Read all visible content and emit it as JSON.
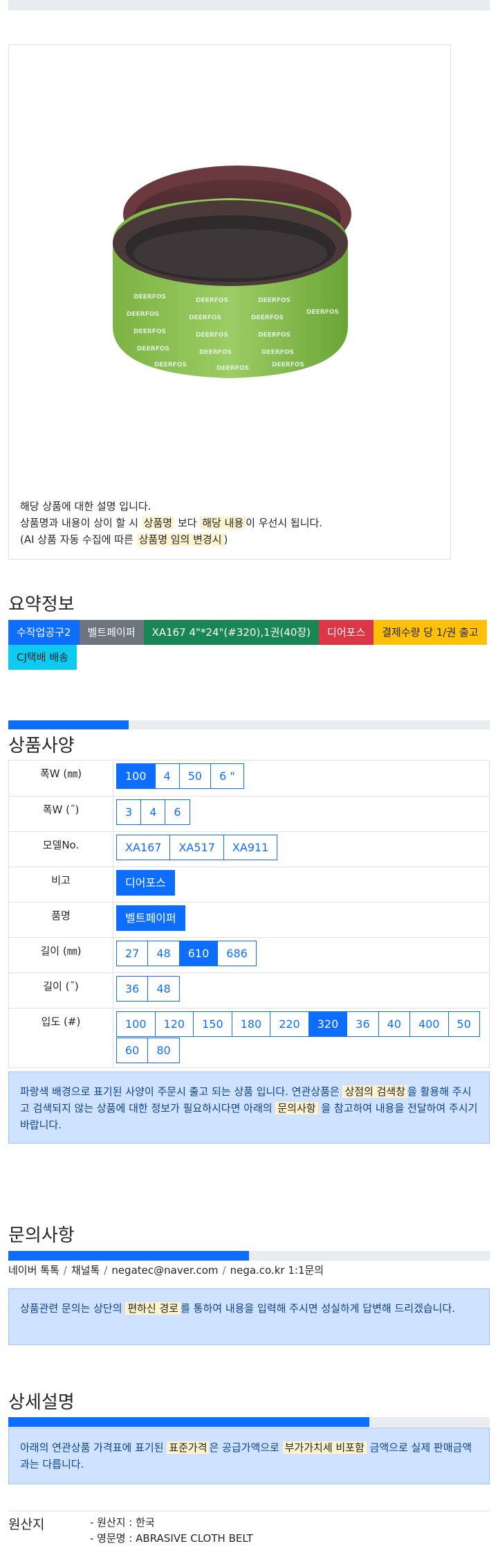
{
  "product_image": {
    "alt": "DEERFOS sanding belts",
    "desc_line1": "해당 상품에 대한 설명 입니다.",
    "desc_line2_a": "상품명과 내용이 상이 할 시 ",
    "desc_line2_mark1": "상품명",
    "desc_line2_b": " 보다 ",
    "desc_line2_mark2": "해당 내용",
    "desc_line2_c": "이 우선시 됩니다.",
    "desc_line3_a": "(AI 상품 자동 수집에 따른 ",
    "desc_line3_mark": "상품명 임의 변경시",
    "desc_line3_b": ")"
  },
  "summary": {
    "title": "요약정보",
    "badges": [
      {
        "label": "수작업공구2",
        "color": "#0d6efd",
        "text": "#ffffff"
      },
      {
        "label": "벨트페이퍼",
        "color": "#6c757d",
        "text": "#ffffff"
      },
      {
        "label": "XA167 4\"*24\"(#320),1권(40장)",
        "color": "#198754",
        "text": "#ffffff"
      },
      {
        "label": "디어포스",
        "color": "#dc3545",
        "text": "#ffffff"
      },
      {
        "label": "결제수량 당 1/권 출고",
        "color": "#ffc107",
        "text": "#212529"
      },
      {
        "label": "CJ택배 배송",
        "color": "#0dcaf0",
        "text": "#212529"
      }
    ]
  },
  "spec": {
    "progress": 0.25,
    "title": "상품사양",
    "rows": [
      {
        "label": "폭W (㎜)",
        "options": [
          {
            "v": "100",
            "on": true
          },
          {
            "v": "4",
            "on": false
          },
          {
            "v": "50",
            "on": false
          },
          {
            "v": "6 \"",
            "on": false
          }
        ]
      },
      {
        "label": "폭W (˝)",
        "options": [
          {
            "v": "3",
            "on": false
          },
          {
            "v": "4",
            "on": false
          },
          {
            "v": "6",
            "on": false
          }
        ]
      },
      {
        "label": "모델No.",
        "options": [
          {
            "v": "XA167",
            "on": false
          },
          {
            "v": "XA517",
            "on": false
          },
          {
            "v": "XA911",
            "on": false
          }
        ]
      },
      {
        "label": "비고",
        "options": [
          {
            "v": "디어포스",
            "on": true
          }
        ]
      },
      {
        "label": "품명",
        "options": [
          {
            "v": "벨트페이퍼",
            "on": true
          }
        ]
      },
      {
        "label": "길이 (㎜)",
        "options": [
          {
            "v": "27",
            "on": false
          },
          {
            "v": "48",
            "on": false
          },
          {
            "v": "610",
            "on": true
          },
          {
            "v": "686",
            "on": false
          }
        ]
      },
      {
        "label": "길이 (˝)",
        "options": [
          {
            "v": "36",
            "on": false
          },
          {
            "v": "48",
            "on": false
          }
        ]
      },
      {
        "label": "입도 (#)",
        "options": [
          {
            "v": "100",
            "on": false
          },
          {
            "v": "120",
            "on": false
          },
          {
            "v": "150",
            "on": false
          },
          {
            "v": "180",
            "on": false
          },
          {
            "v": "220",
            "on": false
          },
          {
            "v": "320",
            "on": true
          },
          {
            "v": "36",
            "on": false
          },
          {
            "v": "40",
            "on": false
          },
          {
            "v": "400",
            "on": false
          },
          {
            "v": "50",
            "on": false
          },
          {
            "v": "60",
            "on": false
          },
          {
            "v": "80",
            "on": false
          }
        ]
      }
    ],
    "notice_a": "파랑색 배경으로 표기된 사양이 주문시 출고 되는 상품 입니다. 연관상품은 ",
    "notice_mark1": "상점의 검색창",
    "notice_b": "을 활용해 주시고 검색되지 않는 상품에 대한 정보가 필요하시다면 아래의 ",
    "notice_mark2": "문의사항",
    "notice_c": " 을 참고하여 내용을 전달하여 주시기 바랍니다."
  },
  "inquiry": {
    "title": "문의사항",
    "progress": 0.5,
    "contacts": [
      "네이버 톡톡",
      "채널톡",
      "negatec@naver.com",
      "nega.co.kr 1:1문의"
    ],
    "notice_a": "상품관련 문의는 상단의 ",
    "notice_mark": "편하신 경로",
    "notice_b": "를 통하여 내용을 입력해 주시면 성실하게 답변해 드리겠습니다."
  },
  "detail": {
    "title": "상세설명",
    "progress": 0.75,
    "notice_a": "아래의 연관상품 가격표에 표기된 ",
    "notice_mark1": "표준가격",
    "notice_b": "은 공급가액으로 ",
    "notice_mark2": "부가가치세 비포함",
    "notice_c": " 금액으로 실제 판매금액과는 다릅니다."
  },
  "origin": {
    "label": "원산지",
    "items": [
      "- 원산지 : 한국",
      "- 영문명 : ABRASIVE CLOTH BELT"
    ]
  }
}
